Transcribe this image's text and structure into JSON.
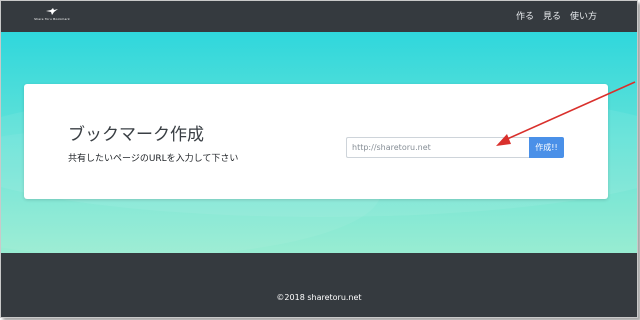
{
  "navbar": {
    "logo_text": "Share Toru Bookmark",
    "links": [
      "作る",
      "見る",
      "使い方"
    ]
  },
  "card": {
    "title": "ブックマーク作成",
    "subtitle": "共有したいページのURLを入力して下さい",
    "input_placeholder": "http://sharetoru.net",
    "button_label": "作成!!"
  },
  "footer": {
    "copyright": "©2018 sharetoru.net"
  },
  "colors": {
    "navbar": "#353a3f",
    "hero_top": "#2fd7dc",
    "hero_bottom": "#98ecd2",
    "button": "#4a90e8",
    "annotation_arrow": "#d9302c"
  },
  "icons": {
    "logo": "bird-icon",
    "annotation": "red-arrow-annotation"
  }
}
